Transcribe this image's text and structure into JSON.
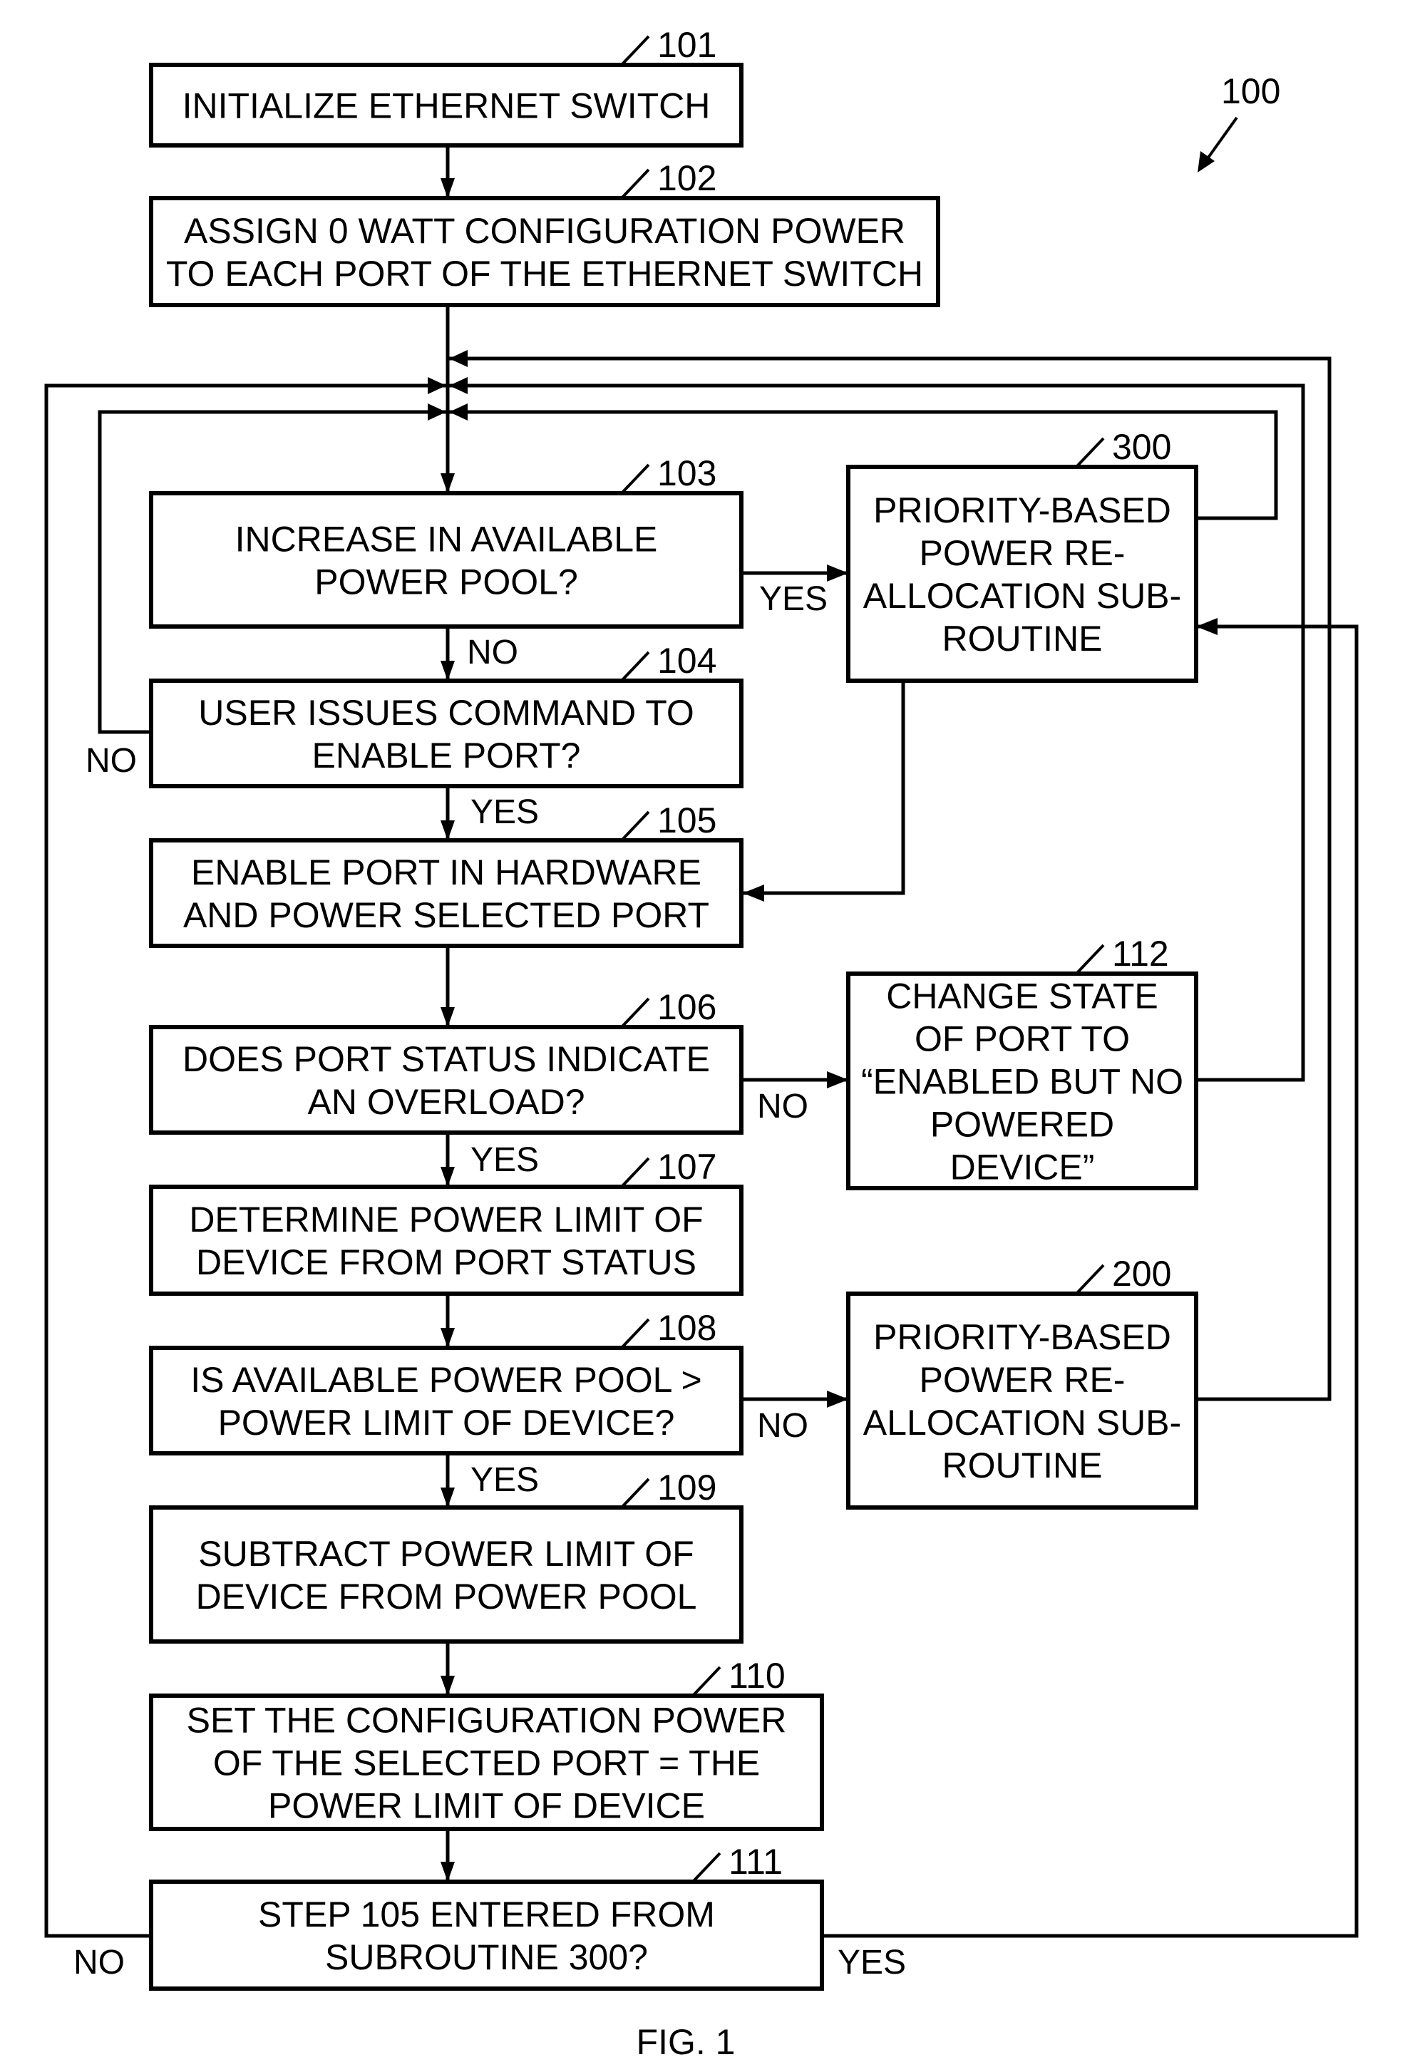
{
  "figure": {
    "caption": "FIG. 1",
    "reference": "100"
  },
  "steps": {
    "s101": {
      "ref": "101",
      "lines": [
        "INITIALIZE ETHERNET SWITCH"
      ]
    },
    "s102": {
      "ref": "102",
      "lines": [
        "ASSIGN 0 WATT CONFIGURATION POWER",
        "TO EACH PORT OF THE ETHERNET SWITCH"
      ]
    },
    "s103": {
      "ref": "103",
      "lines": [
        "INCREASE IN AVAILABLE",
        "POWER POOL?"
      ]
    },
    "s104": {
      "ref": "104",
      "lines": [
        "USER ISSUES COMMAND TO",
        "ENABLE PORT?"
      ]
    },
    "s105": {
      "ref": "105",
      "lines": [
        "ENABLE PORT IN HARDWARE",
        "AND POWER SELECTED PORT"
      ]
    },
    "s106": {
      "ref": "106",
      "lines": [
        "DOES PORT STATUS INDICATE",
        "AN OVERLOAD?"
      ]
    },
    "s107": {
      "ref": "107",
      "lines": [
        "DETERMINE POWER LIMIT OF",
        "DEVICE FROM PORT STATUS"
      ]
    },
    "s108": {
      "ref": "108",
      "lines": [
        "IS AVAILABLE POWER POOL >",
        "POWER LIMIT OF DEVICE?"
      ]
    },
    "s109": {
      "ref": "109",
      "lines": [
        "SUBTRACT POWER LIMIT OF",
        "DEVICE FROM POWER POOL"
      ]
    },
    "s110": {
      "ref": "110",
      "lines": [
        "SET THE CONFIGURATION POWER",
        "OF THE  SELECTED PORT = THE",
        "POWER LIMIT OF DEVICE"
      ]
    },
    "s111": {
      "ref": "111",
      "lines": [
        "STEP 105 ENTERED FROM",
        "SUBROUTINE 300?"
      ]
    },
    "s112": {
      "ref": "112",
      "lines": [
        "CHANGE STATE",
        "OF PORT TO",
        "“ENABLED BUT NO",
        "POWERED",
        "DEVICE”"
      ]
    },
    "s200": {
      "ref": "200",
      "lines": [
        "PRIORITY-BASED",
        "POWER RE-",
        "ALLOCATION SUB-",
        "ROUTINE"
      ]
    },
    "s300": {
      "ref": "300",
      "lines": [
        "PRIORITY-BASED",
        "POWER RE-",
        "ALLOCATION SUB-",
        "ROUTINE"
      ]
    }
  },
  "branch_labels": {
    "b103_yes": "YES",
    "b103_no": "NO",
    "b104_no": "NO",
    "b104_yes": "YES",
    "b106_no": "NO",
    "b106_yes": "YES",
    "b108_no": "NO",
    "b108_yes": "YES",
    "b111_no": "NO",
    "b111_yes": "YES"
  },
  "colors": {
    "ink": "#000000",
    "paper": "#ffffff"
  }
}
